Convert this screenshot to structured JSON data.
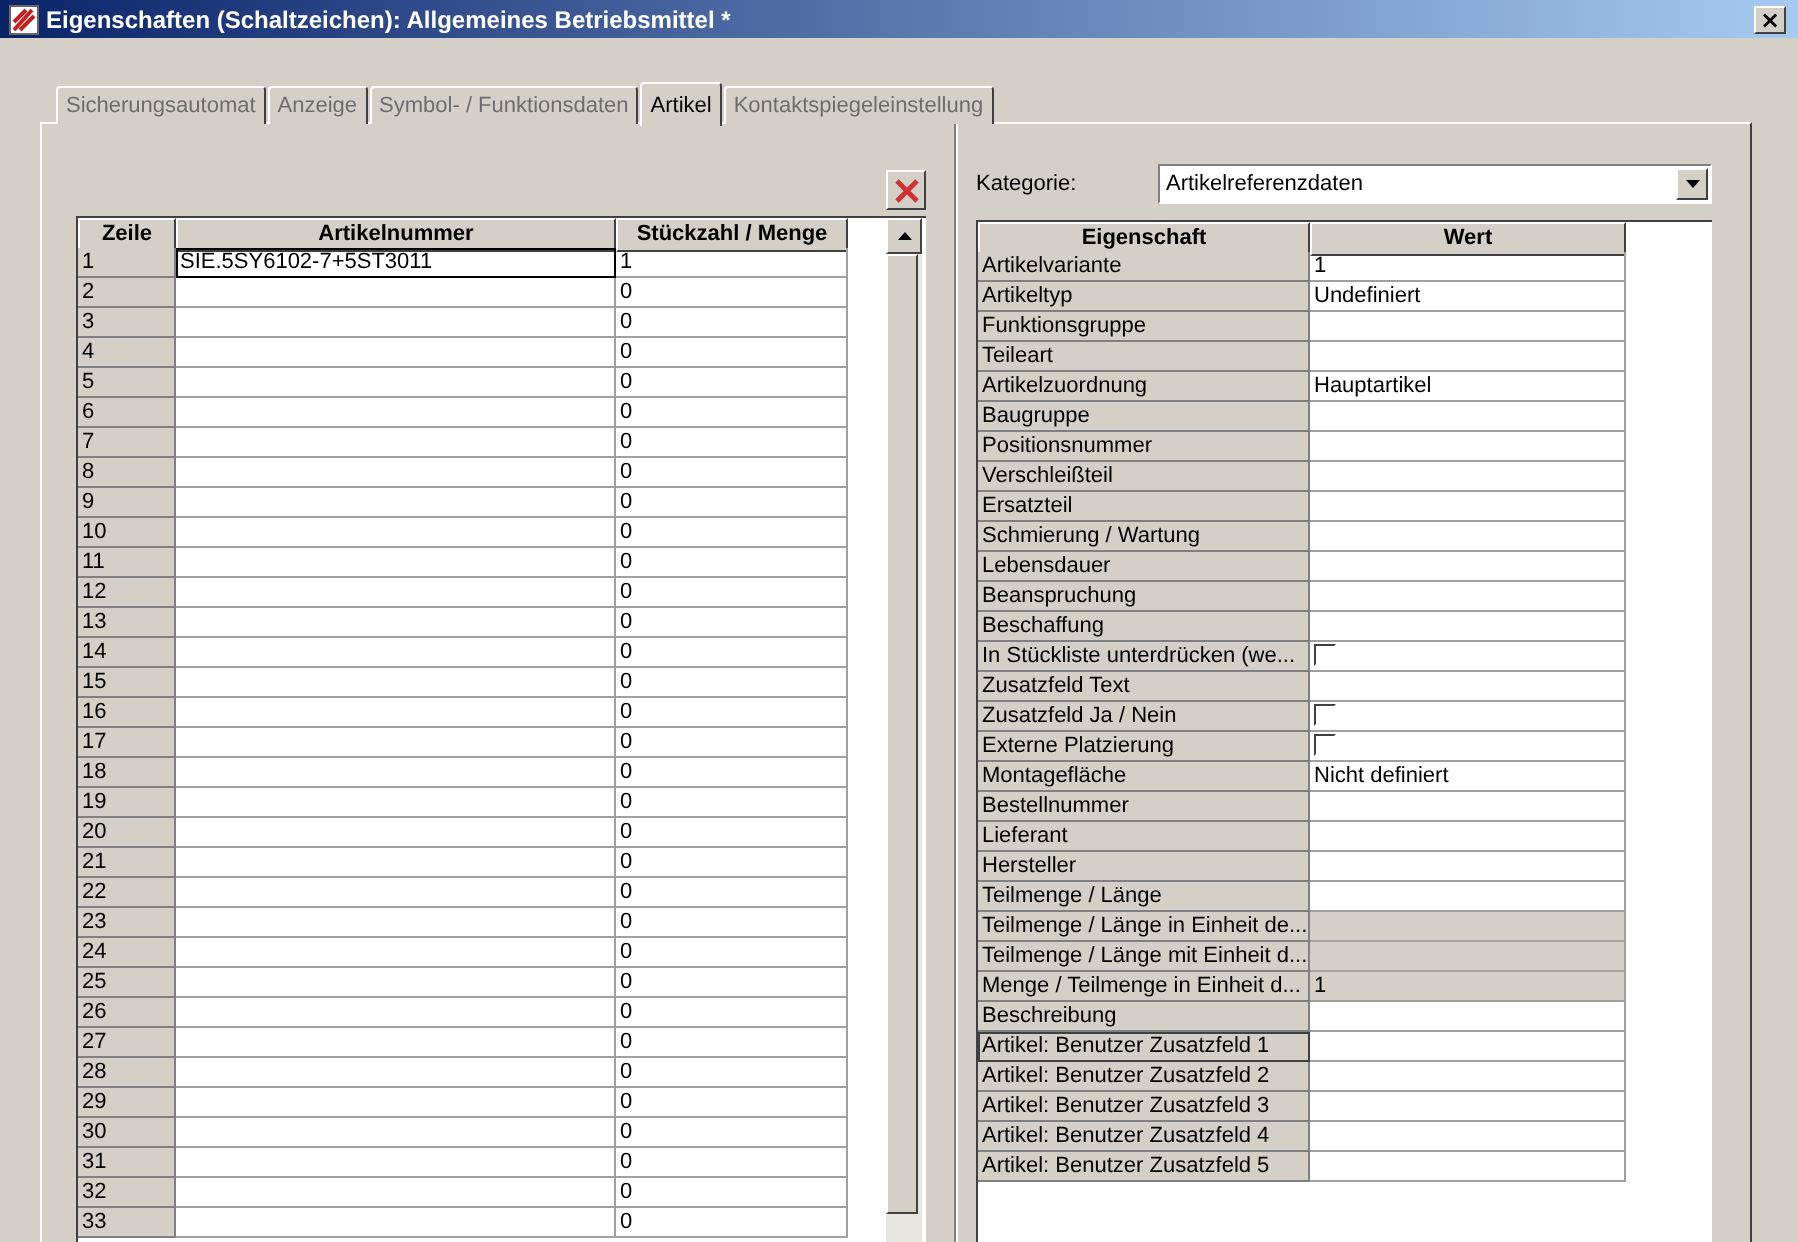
{
  "window": {
    "title": "Eigenschaften (Schaltzeichen): Allgemeines Betriebsmittel *",
    "close": "×"
  },
  "tabs": [
    {
      "label": "Sicherungsautomat",
      "selected": false
    },
    {
      "label": "Anzeige",
      "selected": false
    },
    {
      "label": "Symbol- / Funktionsdaten",
      "selected": false
    },
    {
      "label": "Artikel",
      "selected": true
    },
    {
      "label": "Kontaktspiegeleinstellung",
      "selected": false
    }
  ],
  "article_table": {
    "columns": [
      "Zeile",
      "Artikelnummer",
      "Stückzahl / Menge"
    ],
    "rows": [
      {
        "zeile": "1",
        "artikelnummer": "SIE.5SY6102-7+5ST3011",
        "menge": "1",
        "focused": true
      },
      {
        "zeile": "2",
        "menge": "0",
        "focused": false
      },
      {
        "zeile": "3",
        "menge": "0",
        "focused": false
      },
      {
        "zeile": "4",
        "menge": "0",
        "focused": false
      },
      {
        "zeile": "5",
        "menge": "0",
        "focused": false
      },
      {
        "zeile": "6",
        "menge": "0",
        "focused": false
      },
      {
        "zeile": "7",
        "menge": "0",
        "focused": false
      },
      {
        "zeile": "8",
        "menge": "0",
        "focused": false
      },
      {
        "zeile": "9",
        "menge": "0",
        "focused": false
      },
      {
        "zeile": "10",
        "menge": "0",
        "focused": false
      },
      {
        "zeile": "11",
        "menge": "0",
        "focused": false
      },
      {
        "zeile": "12",
        "menge": "0",
        "focused": false
      },
      {
        "zeile": "13",
        "menge": "0",
        "focused": false
      },
      {
        "zeile": "14",
        "menge": "0",
        "focused": false
      },
      {
        "zeile": "15",
        "menge": "0",
        "focused": false
      },
      {
        "zeile": "16",
        "menge": "0",
        "focused": false
      },
      {
        "zeile": "17",
        "menge": "0",
        "focused": false
      },
      {
        "zeile": "18",
        "menge": "0",
        "focused": false
      },
      {
        "zeile": "19",
        "menge": "0",
        "focused": false
      },
      {
        "zeile": "20",
        "menge": "0",
        "focused": false
      },
      {
        "zeile": "21",
        "menge": "0",
        "focused": false
      },
      {
        "zeile": "22",
        "menge": "0",
        "focused": false
      },
      {
        "zeile": "23",
        "menge": "0",
        "focused": false
      },
      {
        "zeile": "24",
        "menge": "0",
        "focused": false
      },
      {
        "zeile": "25",
        "menge": "0",
        "focused": false
      },
      {
        "zeile": "26",
        "menge": "0",
        "focused": false
      },
      {
        "zeile": "27",
        "menge": "0",
        "focused": false
      },
      {
        "zeile": "28",
        "menge": "0",
        "focused": false
      },
      {
        "zeile": "29",
        "menge": "0",
        "focused": false
      },
      {
        "zeile": "30",
        "menge": "0",
        "focused": false
      },
      {
        "zeile": "31",
        "menge": "0",
        "focused": false
      },
      {
        "zeile": "32",
        "menge": "0",
        "focused": false
      },
      {
        "zeile": "33",
        "menge": "0",
        "focused": false
      }
    ]
  },
  "category": {
    "label": "Kategorie:",
    "value": "Artikelreferenzdaten"
  },
  "property_table": {
    "columns": [
      "Eigenschaft",
      "Wert"
    ],
    "rows": [
      {
        "property": "Artikelvariante",
        "kind": "text",
        "value": "1",
        "readonly": false,
        "focused": false
      },
      {
        "property": "Artikeltyp",
        "kind": "text",
        "value": "Undefiniert",
        "readonly": false,
        "focused": false
      },
      {
        "property": "Funktionsgruppe",
        "kind": "text",
        "readonly": false,
        "focused": false
      },
      {
        "property": "Teileart",
        "kind": "text",
        "readonly": false,
        "focused": false
      },
      {
        "property": "Artikelzuordnung",
        "kind": "text",
        "value": "Hauptartikel",
        "readonly": false,
        "focused": false
      },
      {
        "property": "Baugruppe",
        "kind": "text",
        "readonly": false,
        "focused": false
      },
      {
        "property": "Positionsnummer",
        "kind": "text",
        "readonly": false,
        "focused": false
      },
      {
        "property": "Verschleißteil",
        "kind": "text",
        "readonly": false,
        "focused": false
      },
      {
        "property": "Ersatzteil",
        "kind": "text",
        "readonly": false,
        "focused": false
      },
      {
        "property": "Schmierung / Wartung",
        "kind": "text",
        "readonly": false,
        "focused": false
      },
      {
        "property": "Lebensdauer",
        "kind": "text",
        "readonly": false,
        "focused": false
      },
      {
        "property": "Beanspruchung",
        "kind": "text",
        "readonly": false,
        "focused": false
      },
      {
        "property": "Beschaffung",
        "kind": "text",
        "readonly": false,
        "focused": false
      },
      {
        "property": "In Stückliste unterdrücken (we...",
        "kind": "checkbox",
        "checked": false,
        "readonly": false,
        "focused": false
      },
      {
        "property": "Zusatzfeld Text",
        "kind": "text",
        "readonly": false,
        "focused": false
      },
      {
        "property": "Zusatzfeld Ja / Nein",
        "kind": "checkbox",
        "checked": false,
        "readonly": false,
        "focused": false
      },
      {
        "property": "Externe Platzierung",
        "kind": "checkbox",
        "checked": false,
        "readonly": false,
        "focused": false
      },
      {
        "property": "Montagefläche",
        "kind": "text",
        "value": "Nicht definiert",
        "readonly": false,
        "focused": false
      },
      {
        "property": "Bestellnummer",
        "kind": "text",
        "readonly": false,
        "focused": false
      },
      {
        "property": "Lieferant",
        "kind": "text",
        "readonly": false,
        "focused": false
      },
      {
        "property": "Hersteller",
        "kind": "text",
        "readonly": false,
        "focused": false
      },
      {
        "property": "Teilmenge / Länge",
        "kind": "text",
        "readonly": false,
        "focused": false
      },
      {
        "property": "Teilmenge / Länge in Einheit de...",
        "kind": "text",
        "readonly": true,
        "focused": false
      },
      {
        "property": "Teilmenge / Länge mit Einheit d...",
        "kind": "text",
        "readonly": true,
        "focused": false
      },
      {
        "property": "Menge / Teilmenge in Einheit d...",
        "kind": "text",
        "value": "1",
        "readonly": true,
        "focused": false
      },
      {
        "property": "Beschreibung",
        "kind": "text",
        "readonly": false,
        "focused": false
      },
      {
        "property": "Artikel: Benutzer Zusatzfeld 1",
        "kind": "text",
        "readonly": false,
        "focused": true
      },
      {
        "property": "Artikel: Benutzer Zusatzfeld 2",
        "kind": "text",
        "readonly": false,
        "focused": false
      },
      {
        "property": "Artikel: Benutzer Zusatzfeld 3",
        "kind": "text",
        "readonly": false,
        "focused": false
      },
      {
        "property": "Artikel: Benutzer Zusatzfeld 4",
        "kind": "text",
        "readonly": false,
        "focused": false
      },
      {
        "property": "Artikel: Benutzer Zusatzfeld 5",
        "kind": "text",
        "readonly": false,
        "focused": false
      }
    ]
  }
}
